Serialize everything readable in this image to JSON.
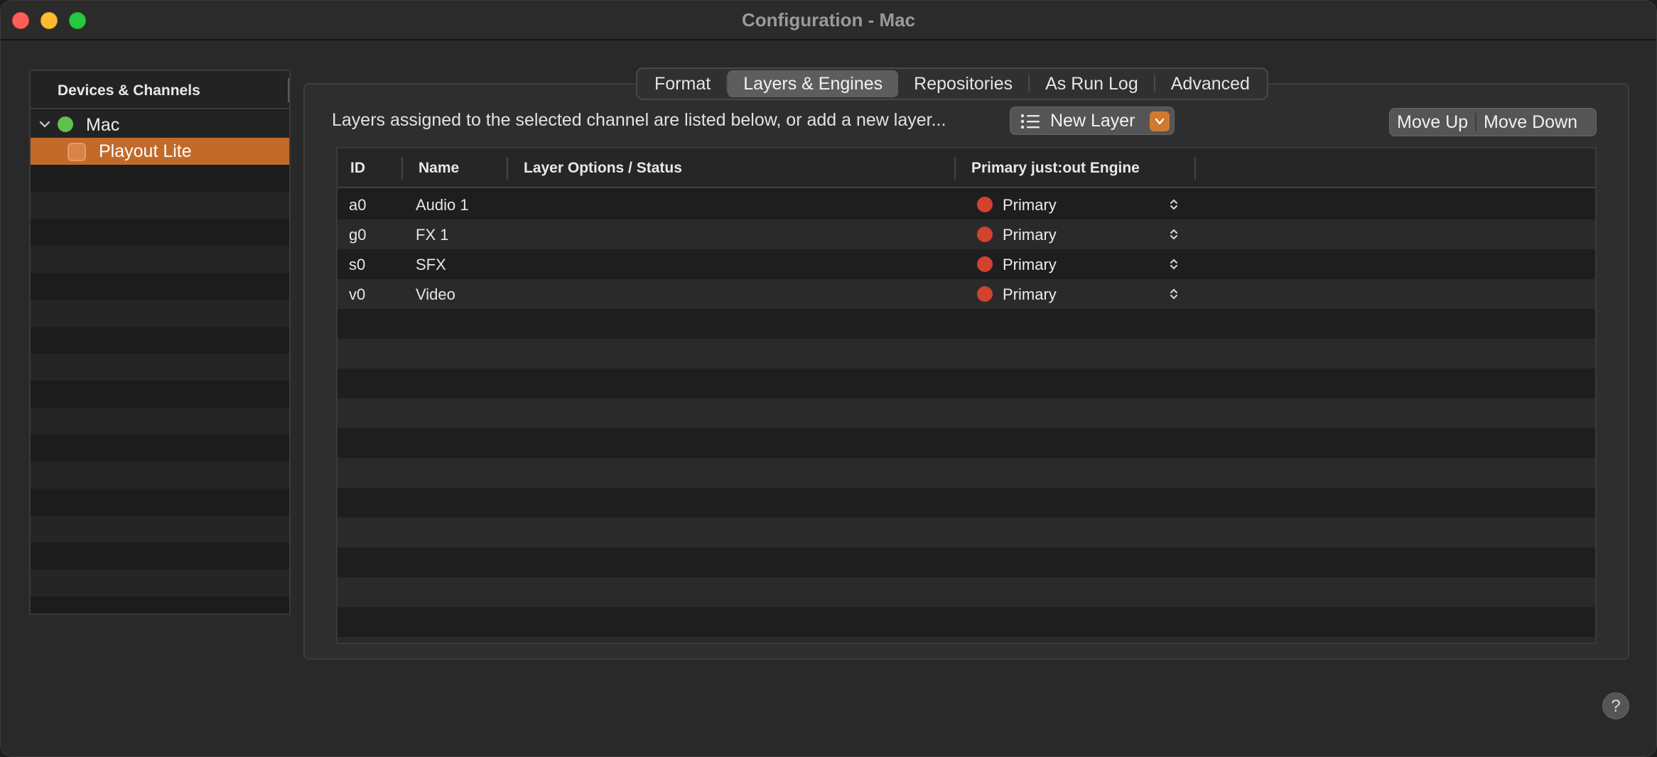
{
  "window": {
    "title": "Configuration - Mac"
  },
  "sidebar": {
    "header": "Devices & Channels",
    "device": {
      "label": "Mac",
      "status_color": "#5fc24f"
    },
    "channel": {
      "label": "Playout Lite",
      "selected_color": "#c26a2a"
    }
  },
  "tabs": [
    {
      "label": "Format",
      "active": false
    },
    {
      "label": "Layers & Engines",
      "active": true
    },
    {
      "label": "Repositories",
      "active": false
    },
    {
      "label": "As Run Log",
      "active": false
    },
    {
      "label": "Advanced",
      "active": false
    }
  ],
  "toolbar": {
    "instruction": "Layers assigned to the selected channel are listed below, or add a new layer...",
    "new_layer_label": "New Layer",
    "move_up_label": "Move Up",
    "move_down_label": "Move Down"
  },
  "table": {
    "columns": [
      "ID",
      "Name",
      "Layer Options / Status",
      "Primary just:out Engine"
    ],
    "rows": [
      {
        "id": "a0",
        "name": "Audio 1",
        "options": "",
        "engine": "Primary"
      },
      {
        "id": "g0",
        "name": "FX 1",
        "options": "",
        "engine": "Primary"
      },
      {
        "id": "s0",
        "name": "SFX",
        "options": "",
        "engine": "Primary"
      },
      {
        "id": "v0",
        "name": "Video",
        "options": "",
        "engine": "Primary"
      }
    ],
    "engine_status_color": "#d2422f"
  },
  "help": {
    "label": "?"
  }
}
